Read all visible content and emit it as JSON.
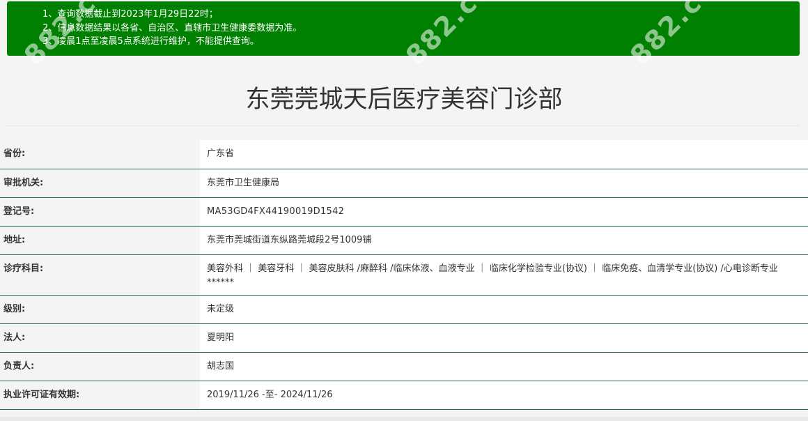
{
  "notice": {
    "lines": [
      "1、查询数据截止到2023年1月29日22时；",
      "2、信息数据结果以各省、自治区、直辖市卫生健康委数据为准。",
      "3、凌晨1点至凌晨5点系统进行维护，不能提供查询。"
    ],
    "background_color": "#008000"
  },
  "watermark": "882.cc",
  "title": "东莞莞城天后医疗美容门诊部",
  "fields": {
    "province": {
      "label": "省份:",
      "value": "广东省"
    },
    "authority": {
      "label": "审批机关:",
      "value": "东莞市卫生健康局"
    },
    "registration": {
      "label": "登记号:",
      "value": "MA53GD4FX44190019D1542"
    },
    "address": {
      "label": "地址:",
      "value": "东莞市莞城街道东纵路莞城段2号1009铺"
    },
    "departments": {
      "label": "诊疗科目:",
      "value": "美容外科 ｜ 美容牙科 ｜ 美容皮肤科 /麻醉科 /临床体液、血液专业 ｜ 临床化学检验专业(协议) ｜ 临床免疫、血清学专业(协议) /心电诊断专业******"
    },
    "level": {
      "label": "级别:",
      "value": "未定级"
    },
    "legal_person": {
      "label": "法人:",
      "value": "夏明阳"
    },
    "person_in_charge": {
      "label": "负责人:",
      "value": "胡志国"
    },
    "license_validity": {
      "label": "执业许可证有效期:",
      "value": "2019/11/26 -至- 2024/11/26"
    }
  },
  "colors": {
    "row_border": "#1e6b4a",
    "label_bg": "#f4f4f4",
    "value_bg": "#ffffff"
  }
}
